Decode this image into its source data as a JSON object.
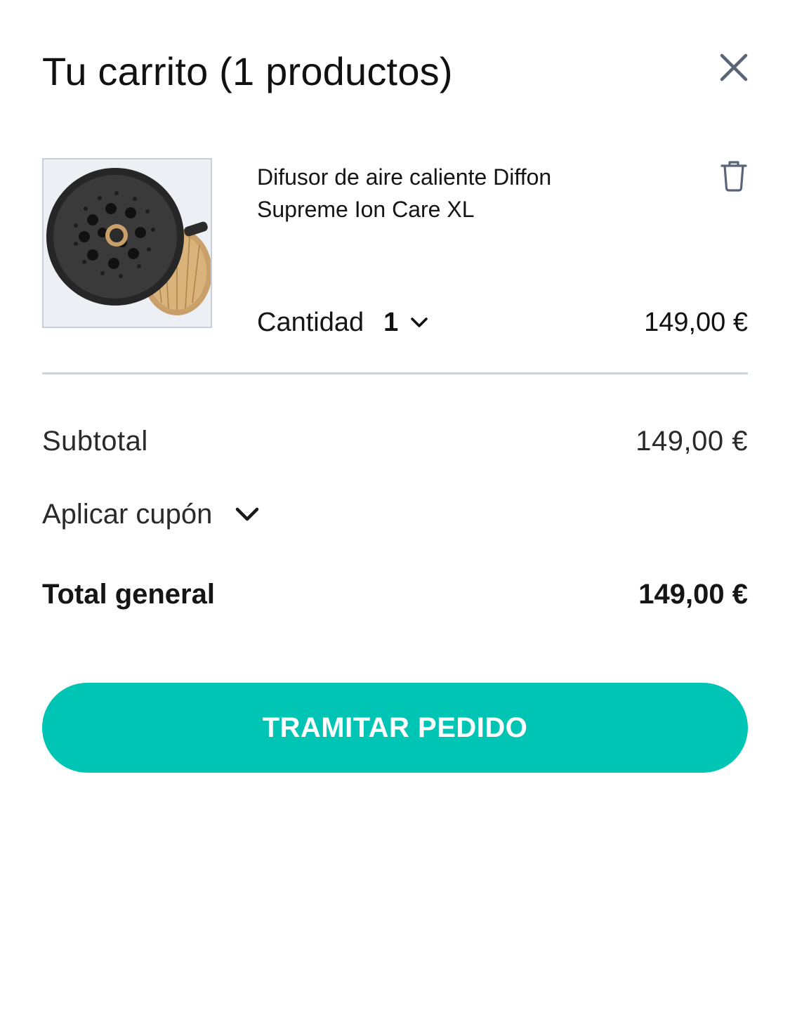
{
  "header": {
    "title": "Tu carrito (1 productos)",
    "close_icon": "close-icon"
  },
  "cart": {
    "items": [
      {
        "name": "Difusor de aire caliente Diffon Supreme Ion Care XL",
        "quantity_label": "Cantidad",
        "quantity": "1",
        "price": "149,00 €",
        "image": "diffuser-product-image",
        "delete_icon": "trash-icon"
      }
    ]
  },
  "summary": {
    "subtotal_label": "Subtotal",
    "subtotal_value": "149,00 €",
    "coupon_label": "Aplicar cupón",
    "total_label": "Total general",
    "total_value": "149,00 €"
  },
  "checkout": {
    "label": "TRAMITAR PEDIDO"
  },
  "colors": {
    "accent": "#00c5b5",
    "icon": "#5b6577",
    "divider": "#cfd3da"
  }
}
